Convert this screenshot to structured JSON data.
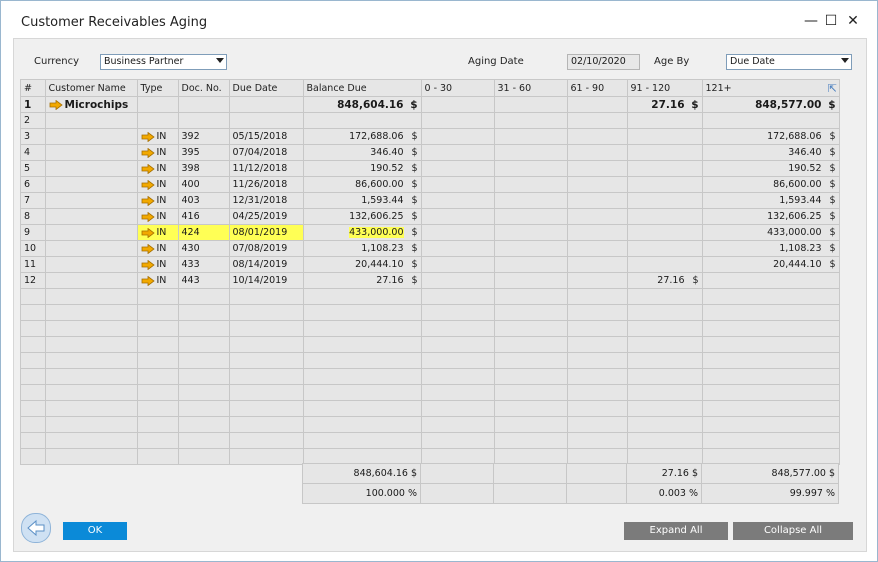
{
  "window": {
    "title": "Customer Receivables Aging",
    "minimize": "—",
    "maximize": "☐",
    "close": "✕"
  },
  "filters": {
    "currency_label": "Currency",
    "currency_value": "Business Partner",
    "aging_date_label": "Aging Date",
    "aging_date_value": "02/10/2020",
    "age_by_label": "Age By",
    "age_by_value": "Due Date"
  },
  "grid": {
    "columns": [
      "#",
      "Customer Name",
      "Type",
      "Doc. No.",
      "Due Date",
      "Balance Due",
      "0 - 30",
      "31 - 60",
      "61 - 90",
      "91 - 120",
      "121+"
    ],
    "rows": [
      {
        "num": "1",
        "customer": "Microchips",
        "type": "",
        "doc": "",
        "due": "",
        "balance": "848,604.16",
        "b_cur": "$",
        "c030": "",
        "c3160": "",
        "c6190": "",
        "c91120": "27.16",
        "c91_cur": "$",
        "c121": "848,577.00",
        "c121_cur": "$",
        "bold": true,
        "arrow": true,
        "highlight": false
      },
      {
        "num": "2",
        "customer": "",
        "type": "",
        "doc": "",
        "due": "",
        "balance": "",
        "b_cur": "",
        "c030": "",
        "c3160": "",
        "c6190": "",
        "c91120": "",
        "c91_cur": "",
        "c121": "",
        "c121_cur": "",
        "bold": false,
        "arrow": false,
        "highlight": false
      },
      {
        "num": "3",
        "customer": "",
        "type": "IN",
        "doc": "392",
        "due": "05/15/2018",
        "balance": "172,688.06",
        "b_cur": "$",
        "c030": "",
        "c3160": "",
        "c6190": "",
        "c91120": "",
        "c91_cur": "",
        "c121": "172,688.06",
        "c121_cur": "$",
        "bold": false,
        "arrow": true,
        "highlight": false
      },
      {
        "num": "4",
        "customer": "",
        "type": "IN",
        "doc": "395",
        "due": "07/04/2018",
        "balance": "346.40",
        "b_cur": "$",
        "c030": "",
        "c3160": "",
        "c6190": "",
        "c91120": "",
        "c91_cur": "",
        "c121": "346.40",
        "c121_cur": "$",
        "bold": false,
        "arrow": true,
        "highlight": false
      },
      {
        "num": "5",
        "customer": "",
        "type": "IN",
        "doc": "398",
        "due": "11/12/2018",
        "balance": "190.52",
        "b_cur": "$",
        "c030": "",
        "c3160": "",
        "c6190": "",
        "c91120": "",
        "c91_cur": "",
        "c121": "190.52",
        "c121_cur": "$",
        "bold": false,
        "arrow": true,
        "highlight": false
      },
      {
        "num": "6",
        "customer": "",
        "type": "IN",
        "doc": "400",
        "due": "11/26/2018",
        "balance": "86,600.00",
        "b_cur": "$",
        "c030": "",
        "c3160": "",
        "c6190": "",
        "c91120": "",
        "c91_cur": "",
        "c121": "86,600.00",
        "c121_cur": "$",
        "bold": false,
        "arrow": true,
        "highlight": false
      },
      {
        "num": "7",
        "customer": "",
        "type": "IN",
        "doc": "403",
        "due": "12/31/2018",
        "balance": "1,593.44",
        "b_cur": "$",
        "c030": "",
        "c3160": "",
        "c6190": "",
        "c91120": "",
        "c91_cur": "",
        "c121": "1,593.44",
        "c121_cur": "$",
        "bold": false,
        "arrow": true,
        "highlight": false
      },
      {
        "num": "8",
        "customer": "",
        "type": "IN",
        "doc": "416",
        "due": "04/25/2019",
        "balance": "132,606.25",
        "b_cur": "$",
        "c030": "",
        "c3160": "",
        "c6190": "",
        "c91120": "",
        "c91_cur": "",
        "c121": "132,606.25",
        "c121_cur": "$",
        "bold": false,
        "arrow": true,
        "highlight": false
      },
      {
        "num": "9",
        "customer": "",
        "type": "IN",
        "doc": "424",
        "due": "08/01/2019",
        "balance": "433,000.00",
        "b_cur": "$",
        "c030": "",
        "c3160": "",
        "c6190": "",
        "c91120": "",
        "c91_cur": "",
        "c121": "433,000.00",
        "c121_cur": "$",
        "bold": false,
        "arrow": true,
        "highlight": true
      },
      {
        "num": "10",
        "customer": "",
        "type": "IN",
        "doc": "430",
        "due": "07/08/2019",
        "balance": "1,108.23",
        "b_cur": "$",
        "c030": "",
        "c3160": "",
        "c6190": "",
        "c91120": "",
        "c91_cur": "",
        "c121": "1,108.23",
        "c121_cur": "$",
        "bold": false,
        "arrow": true,
        "highlight": false
      },
      {
        "num": "11",
        "customer": "",
        "type": "IN",
        "doc": "433",
        "due": "08/14/2019",
        "balance": "20,444.10",
        "b_cur": "$",
        "c030": "",
        "c3160": "",
        "c6190": "",
        "c91120": "",
        "c91_cur": "",
        "c121": "20,444.10",
        "c121_cur": "$",
        "bold": false,
        "arrow": true,
        "highlight": false
      },
      {
        "num": "12",
        "customer": "",
        "type": "IN",
        "doc": "443",
        "due": "10/14/2019",
        "balance": "27.16",
        "b_cur": "$",
        "c030": "",
        "c3160": "",
        "c6190": "",
        "c91120": "27.16",
        "c91_cur": "$",
        "c121": "",
        "c121_cur": "",
        "bold": false,
        "arrow": true,
        "highlight": false
      }
    ],
    "empty_rows": 11
  },
  "totals": {
    "balance": "848,604.16 $",
    "c91120": "27.16 $",
    "c121": "848,577.00 $",
    "balance_pct": "100.000 %",
    "c91120_pct": "0.003 %",
    "c121_pct": "99.997 %"
  },
  "buttons": {
    "ok": "OK",
    "expand_all": "Expand All",
    "collapse_all": "Collapse All"
  },
  "colors": {
    "accent": "#1f95e0",
    "ok_button": "#0b8ad8",
    "gray_button": "#7b7b7b",
    "highlight": "#ffff55",
    "link_arrow": "#f2a900"
  }
}
